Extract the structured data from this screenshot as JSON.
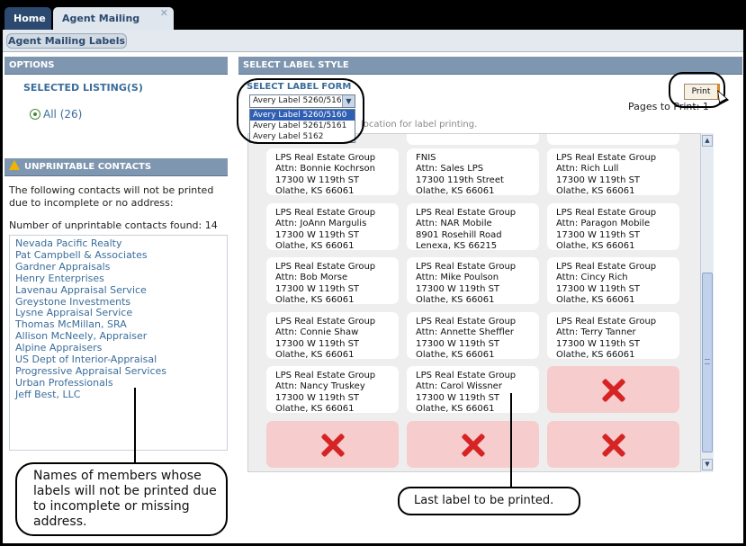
{
  "tabs": [
    {
      "label": "Home"
    },
    {
      "label": "Agent Mailing Labels"
    }
  ],
  "subbar": {
    "button_label": "Agent Mailing Labels"
  },
  "options": {
    "header": "OPTIONS",
    "selected_listings": "SELECTED LISTING(S)",
    "all_label": "All (26)"
  },
  "unprintable": {
    "header": "UNPRINTABLE CONTACTS",
    "description": "The following contacts will not be printed due to incomplete or no address:",
    "count_text": "Number of unprintable contacts found: 14",
    "contacts": [
      "Nevada Pacific Realty",
      "Pat Campbell & Associates",
      "Gardner Appraisals",
      "Henry Enterprises",
      "Lavenau Appraisal Service",
      "Greystone Investments",
      "Lysne Appraisal Service",
      "Thomas McMillan, SRA",
      "Allison McNeely, Appraiser",
      "Alpine Appraisers",
      "US Dept of Interior-Appraisal",
      "Progressive Appraisal Services",
      "Urban Professionals",
      "Jeff Best, LLC"
    ]
  },
  "label_style": {
    "header": "SELECT LABEL STYLE",
    "form_label": "SELECT LABEL FORM",
    "selected": "Avery Label 5260/5160",
    "options": [
      "Avery Label 5260/5160",
      "Avery Label 5261/5161",
      "Avery Label 5162"
    ],
    "hint": "location for label printing.",
    "print_label": "Print",
    "pages_to_print": "Pages to Print:  1"
  },
  "labels": [
    {
      "lines": [
        "LPS Real Estate Group",
        "Attn: Bonnie Kochrson",
        "17300 W 119th ST",
        "Olathe, KS 66061"
      ]
    },
    {
      "lines": [
        "FNIS",
        "Attn: Sales LPS",
        "17300 119th Street",
        "Olathe, KS 66061"
      ]
    },
    {
      "lines": [
        "LPS Real Estate Group",
        "Attn: Rich Lull",
        "17300 W 119th ST",
        "Olathe, KS 66061"
      ]
    },
    {
      "lines": [
        "LPS Real Estate Group",
        "Attn: JoAnn Margulis",
        "17300 W 119th ST",
        "Olathe, KS 66061"
      ]
    },
    {
      "lines": [
        "LPS Real Estate Group",
        "Attn: NAR Mobile",
        "8901 Rosehill Road",
        "Lenexa, KS 66215"
      ]
    },
    {
      "lines": [
        "LPS Real Estate Group",
        "Attn: Paragon Mobile",
        "17300 W 119th ST",
        "Olathe, KS 66061"
      ]
    },
    {
      "lines": [
        "LPS Real Estate Group",
        "Attn: Bob Morse",
        "17300 W 119th ST",
        "Olathe, KS 66061"
      ]
    },
    {
      "lines": [
        "LPS Real Estate Group",
        "Attn: Mike Poulson",
        "17300 W 119th ST",
        "Olathe, KS 66061"
      ]
    },
    {
      "lines": [
        "LPS Real Estate Group",
        "Attn: Cincy Rich",
        "17300 W 119th ST",
        "Olathe, KS 66061"
      ]
    },
    {
      "lines": [
        "LPS Real Estate Group",
        "Attn: Connie Shaw",
        "17300 W 119th ST",
        "Olathe, KS 66061"
      ]
    },
    {
      "lines": [
        "LPS Real Estate Group",
        "Attn: Annette Sheffler",
        "17300 W 119th ST",
        "Olathe, KS 66061"
      ]
    },
    {
      "lines": [
        "LPS Real Estate Group",
        "Attn: Terry Tanner",
        "17300 W 119th ST",
        "Olathe, KS 66061"
      ]
    },
    {
      "lines": [
        "LPS Real Estate Group",
        "Attn: Nancy Truskey",
        "17300 W 119th ST",
        "Olathe, KS 66061"
      ]
    },
    {
      "lines": [
        "LPS Real Estate Group",
        "Attn: Carol Wissner",
        "17300 W 119th ST",
        "Olathe, KS 66061"
      ]
    }
  ],
  "callouts": {
    "left": "Names of members whose labels will not be printed due to incomplete or missing address.",
    "right": "Last label to be printed."
  }
}
